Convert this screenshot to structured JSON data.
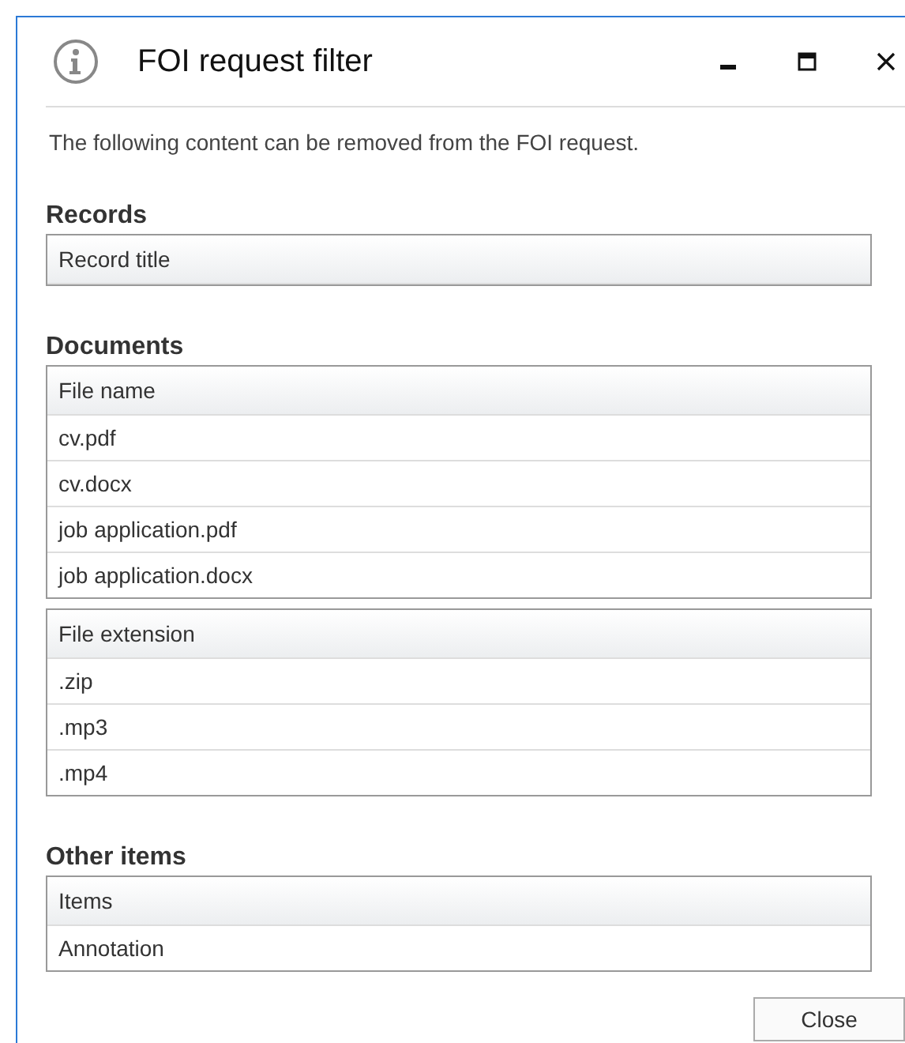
{
  "window": {
    "title": "FOI request filter"
  },
  "description": "The following content can be removed from the FOI request.",
  "sections": [
    {
      "heading": "Records",
      "tables": [
        {
          "header": "Record title"
        }
      ]
    },
    {
      "heading": "Documents",
      "tables": [
        {
          "header": "File name",
          "rows": [
            "cv.pdf",
            "cv.docx",
            "job application.pdf",
            "job application.docx"
          ]
        },
        {
          "header": "File extension",
          "rows": [
            ".zip",
            ".mp3",
            ".mp4"
          ]
        }
      ]
    },
    {
      "heading": "Other items",
      "tables": [
        {
          "header": "Items",
          "rows": [
            "Annotation"
          ]
        }
      ]
    }
  ],
  "buttons": [
    "Close"
  ]
}
